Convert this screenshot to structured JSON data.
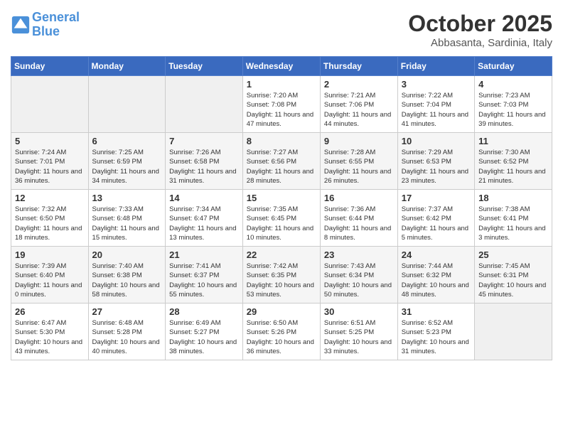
{
  "header": {
    "logo_line1": "General",
    "logo_line2": "Blue",
    "month": "October 2025",
    "location": "Abbasanta, Sardinia, Italy"
  },
  "days_of_week": [
    "Sunday",
    "Monday",
    "Tuesday",
    "Wednesday",
    "Thursday",
    "Friday",
    "Saturday"
  ],
  "weeks": [
    [
      {
        "day": "",
        "info": ""
      },
      {
        "day": "",
        "info": ""
      },
      {
        "day": "",
        "info": ""
      },
      {
        "day": "1",
        "info": "Sunrise: 7:20 AM\nSunset: 7:08 PM\nDaylight: 11 hours and 47 minutes."
      },
      {
        "day": "2",
        "info": "Sunrise: 7:21 AM\nSunset: 7:06 PM\nDaylight: 11 hours and 44 minutes."
      },
      {
        "day": "3",
        "info": "Sunrise: 7:22 AM\nSunset: 7:04 PM\nDaylight: 11 hours and 41 minutes."
      },
      {
        "day": "4",
        "info": "Sunrise: 7:23 AM\nSunset: 7:03 PM\nDaylight: 11 hours and 39 minutes."
      }
    ],
    [
      {
        "day": "5",
        "info": "Sunrise: 7:24 AM\nSunset: 7:01 PM\nDaylight: 11 hours and 36 minutes."
      },
      {
        "day": "6",
        "info": "Sunrise: 7:25 AM\nSunset: 6:59 PM\nDaylight: 11 hours and 34 minutes."
      },
      {
        "day": "7",
        "info": "Sunrise: 7:26 AM\nSunset: 6:58 PM\nDaylight: 11 hours and 31 minutes."
      },
      {
        "day": "8",
        "info": "Sunrise: 7:27 AM\nSunset: 6:56 PM\nDaylight: 11 hours and 28 minutes."
      },
      {
        "day": "9",
        "info": "Sunrise: 7:28 AM\nSunset: 6:55 PM\nDaylight: 11 hours and 26 minutes."
      },
      {
        "day": "10",
        "info": "Sunrise: 7:29 AM\nSunset: 6:53 PM\nDaylight: 11 hours and 23 minutes."
      },
      {
        "day": "11",
        "info": "Sunrise: 7:30 AM\nSunset: 6:52 PM\nDaylight: 11 hours and 21 minutes."
      }
    ],
    [
      {
        "day": "12",
        "info": "Sunrise: 7:32 AM\nSunset: 6:50 PM\nDaylight: 11 hours and 18 minutes."
      },
      {
        "day": "13",
        "info": "Sunrise: 7:33 AM\nSunset: 6:48 PM\nDaylight: 11 hours and 15 minutes."
      },
      {
        "day": "14",
        "info": "Sunrise: 7:34 AM\nSunset: 6:47 PM\nDaylight: 11 hours and 13 minutes."
      },
      {
        "day": "15",
        "info": "Sunrise: 7:35 AM\nSunset: 6:45 PM\nDaylight: 11 hours and 10 minutes."
      },
      {
        "day": "16",
        "info": "Sunrise: 7:36 AM\nSunset: 6:44 PM\nDaylight: 11 hours and 8 minutes."
      },
      {
        "day": "17",
        "info": "Sunrise: 7:37 AM\nSunset: 6:42 PM\nDaylight: 11 hours and 5 minutes."
      },
      {
        "day": "18",
        "info": "Sunrise: 7:38 AM\nSunset: 6:41 PM\nDaylight: 11 hours and 3 minutes."
      }
    ],
    [
      {
        "day": "19",
        "info": "Sunrise: 7:39 AM\nSunset: 6:40 PM\nDaylight: 11 hours and 0 minutes."
      },
      {
        "day": "20",
        "info": "Sunrise: 7:40 AM\nSunset: 6:38 PM\nDaylight: 10 hours and 58 minutes."
      },
      {
        "day": "21",
        "info": "Sunrise: 7:41 AM\nSunset: 6:37 PM\nDaylight: 10 hours and 55 minutes."
      },
      {
        "day": "22",
        "info": "Sunrise: 7:42 AM\nSunset: 6:35 PM\nDaylight: 10 hours and 53 minutes."
      },
      {
        "day": "23",
        "info": "Sunrise: 7:43 AM\nSunset: 6:34 PM\nDaylight: 10 hours and 50 minutes."
      },
      {
        "day": "24",
        "info": "Sunrise: 7:44 AM\nSunset: 6:32 PM\nDaylight: 10 hours and 48 minutes."
      },
      {
        "day": "25",
        "info": "Sunrise: 7:45 AM\nSunset: 6:31 PM\nDaylight: 10 hours and 45 minutes."
      }
    ],
    [
      {
        "day": "26",
        "info": "Sunrise: 6:47 AM\nSunset: 5:30 PM\nDaylight: 10 hours and 43 minutes."
      },
      {
        "day": "27",
        "info": "Sunrise: 6:48 AM\nSunset: 5:28 PM\nDaylight: 10 hours and 40 minutes."
      },
      {
        "day": "28",
        "info": "Sunrise: 6:49 AM\nSunset: 5:27 PM\nDaylight: 10 hours and 38 minutes."
      },
      {
        "day": "29",
        "info": "Sunrise: 6:50 AM\nSunset: 5:26 PM\nDaylight: 10 hours and 36 minutes."
      },
      {
        "day": "30",
        "info": "Sunrise: 6:51 AM\nSunset: 5:25 PM\nDaylight: 10 hours and 33 minutes."
      },
      {
        "day": "31",
        "info": "Sunrise: 6:52 AM\nSunset: 5:23 PM\nDaylight: 10 hours and 31 minutes."
      },
      {
        "day": "",
        "info": ""
      }
    ]
  ]
}
